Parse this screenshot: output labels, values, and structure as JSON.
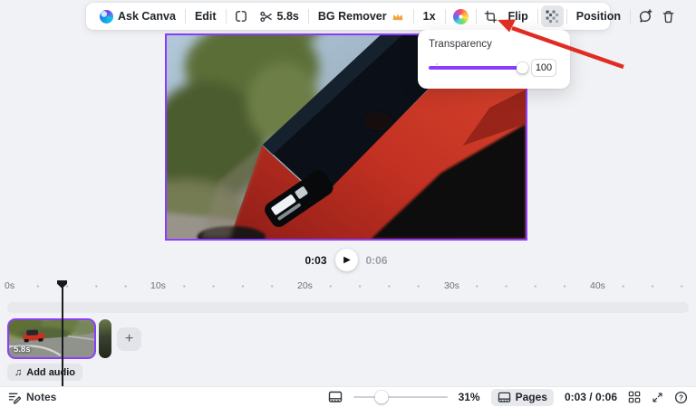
{
  "toolbar": {
    "ask_canva": "Ask Canva",
    "edit": "Edit",
    "clip_duration": "5.8s",
    "bg_remover": "BG Remover",
    "speed": "1x",
    "flip": "Flip",
    "position": "Position"
  },
  "transparency_popup": {
    "title": "Transparency",
    "value": "100",
    "slider_percent": 100
  },
  "player": {
    "current_time": "0:03",
    "total_time": "0:06"
  },
  "timeline": {
    "ruler_labels": [
      "0s",
      "10s",
      "20s",
      "30s",
      "40s"
    ],
    "clip_duration": "5.8s",
    "add_audio_label": "Add audio"
  },
  "bottom_bar": {
    "notes_label": "Notes",
    "zoom_level": "31%",
    "zoom_slider_percent": 30,
    "pages_label": "Pages",
    "time_display": "0:03 / 0:06"
  },
  "icons": {
    "play_glyph": "▶",
    "plus_glyph": "+",
    "music_glyph": "♫",
    "help_glyph": "?"
  },
  "colors": {
    "accent_purple": "#8b3dff",
    "annotation_arrow_red": "#e02d23",
    "crown_gold": "#f2a33c"
  }
}
